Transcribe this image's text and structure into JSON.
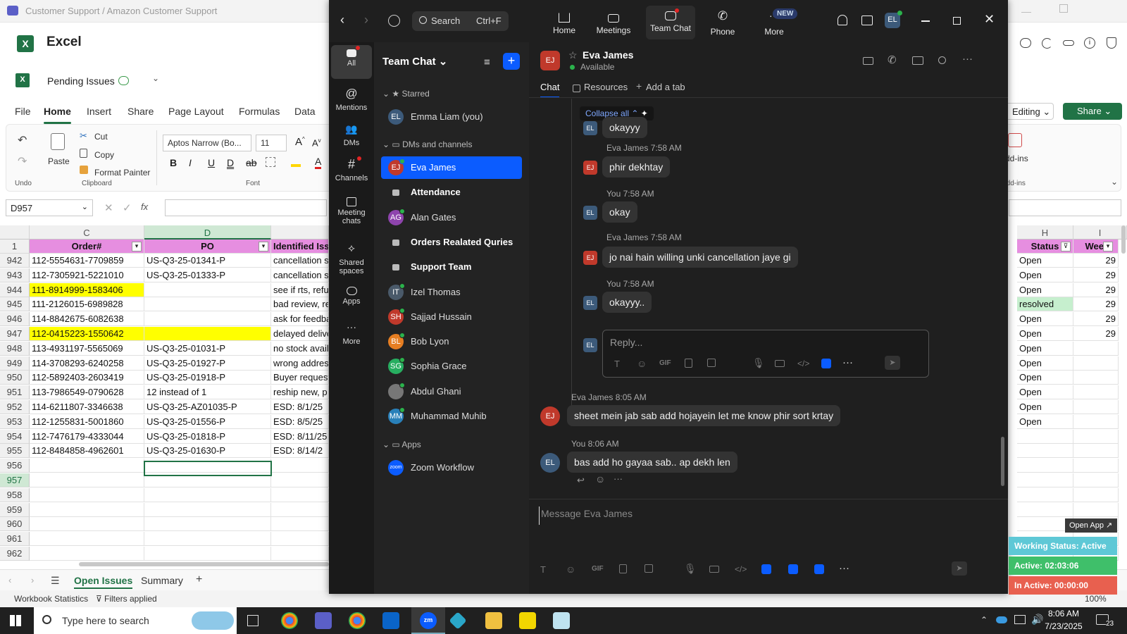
{
  "excel": {
    "window_title": "Customer Support / Amazon Customer Support",
    "app_name": "Excel",
    "file_name": "Pending Issues",
    "menu_tabs": [
      "File",
      "Home",
      "Insert",
      "Share",
      "Page Layout",
      "Formulas",
      "Data"
    ],
    "active_tab": "Home",
    "editing_label": "Editing",
    "share_label": "Share",
    "ribbon": {
      "undo": "Undo",
      "paste": "Paste",
      "cut": "Cut",
      "copy": "Copy",
      "format_painter": "Format Painter",
      "clipboard_group": "Clipboard",
      "font_name": "Aptos Narrow (Bo...",
      "font_size": "11",
      "font_group": "Font",
      "addins": "Add-ins",
      "addins_group": "Add-ins"
    },
    "name_box": "D957",
    "formula_fx": "fx",
    "col_headers": {
      "c": "C",
      "d": "D",
      "h": "H",
      "i": "I"
    },
    "header_row": {
      "num": "1",
      "order": "Order#",
      "po": "PO",
      "issue": "Identified Issu",
      "status": "Status",
      "week": "Weel"
    },
    "rows": [
      {
        "num": "942",
        "order": "112-5554631-7709859",
        "po": "US-Q3-25-01341-P",
        "issue": "cancellation s",
        "status": "Open",
        "week": "29"
      },
      {
        "num": "943",
        "order": "112-7305921-5221010",
        "po": "US-Q3-25-01333-P",
        "issue": "cancellation s",
        "status": "Open",
        "week": "29"
      },
      {
        "num": "944",
        "order": "111-8914999-1583406",
        "po": "",
        "issue": "see if rts, refu",
        "status": "Open",
        "week": "29"
      },
      {
        "num": "945",
        "order": "111-2126015-6989828",
        "po": "",
        "issue": "bad review, re",
        "status": "resolved",
        "week": "29"
      },
      {
        "num": "946",
        "order": "114-8842675-6082638",
        "po": "",
        "issue": "ask for feedba",
        "status": "Open",
        "week": "29"
      },
      {
        "num": "947",
        "order": "112-0415223-1550642",
        "po": "",
        "issue": "delayed delive",
        "status": "Open",
        "week": "29"
      },
      {
        "num": "948",
        "order": "113-4931197-5565069",
        "po": "US-Q3-25-01031-P",
        "issue": "no stock avail",
        "status": "Open",
        "week": ""
      },
      {
        "num": "949",
        "order": "114-3708293-6240258",
        "po": "US-Q3-25-01927-P",
        "issue": "wrong addres",
        "status": "Open",
        "week": ""
      },
      {
        "num": "950",
        "order": "112-5892403-2603419",
        "po": "US-Q3-25-01918-P",
        "issue": "Buyer request",
        "status": "Open",
        "week": ""
      },
      {
        "num": "951",
        "order": "113-7986549-0790628",
        "po": "12 instead of 1",
        "issue": "reship new, p",
        "status": "Open",
        "week": ""
      },
      {
        "num": "952",
        "order": "114-6211807-3346638",
        "po": "US-Q3-25-AZ01035-P",
        "issue": "ESD: 8/1/25",
        "status": "Open",
        "week": ""
      },
      {
        "num": "953",
        "order": "112-1255831-5001860",
        "po": "US-Q3-25-01556-P",
        "issue": "ESD: 8/5/25",
        "status": "Open",
        "week": ""
      },
      {
        "num": "954",
        "order": "112-7476179-4333044",
        "po": "US-Q3-25-01818-P",
        "issue": "ESD: 8/11/25",
        "status": "",
        "week": ""
      },
      {
        "num": "955",
        "order": "112-8484858-4962601",
        "po": "US-Q3-25-01630-P",
        "issue": " ESD: 8/14/2",
        "status": "",
        "week": ""
      },
      {
        "num": "956",
        "order": "",
        "po": "",
        "issue": "",
        "status": "",
        "week": ""
      },
      {
        "num": "957",
        "order": "",
        "po": "",
        "issue": "",
        "status": "",
        "week": ""
      },
      {
        "num": "958",
        "order": "",
        "po": "",
        "issue": "",
        "status": "",
        "week": ""
      },
      {
        "num": "959",
        "order": "",
        "po": "",
        "issue": "",
        "status": "",
        "week": ""
      },
      {
        "num": "960",
        "order": "",
        "po": "",
        "issue": "",
        "status": "",
        "week": ""
      },
      {
        "num": "961",
        "order": "",
        "po": "",
        "issue": "",
        "status": "",
        "week": ""
      },
      {
        "num": "962",
        "order": "",
        "po": "",
        "issue": "",
        "status": "",
        "week": ""
      }
    ],
    "sheet_tabs": [
      "Open Issues",
      "Summary"
    ],
    "active_sheet": "Open Issues",
    "status_left": "Workbook Statistics",
    "status_filters": "Filters applied",
    "zoom_level": "100%"
  },
  "zoom": {
    "search_label": "Search",
    "search_shortcut": "Ctrl+F",
    "nav": [
      "Home",
      "Meetings",
      "Team Chat",
      "Phone",
      "More"
    ],
    "new_badge": "NEW",
    "user_initials": "EL",
    "rail": [
      "All",
      "Mentions",
      "DMs",
      "Channels",
      "Meeting chats",
      "Shared spaces",
      "Apps",
      "More"
    ],
    "list_title": "Team Chat",
    "starred_label": "Starred",
    "dms_label": "DMs and channels",
    "apps_label": "Apps",
    "starred": [
      {
        "initials": "EL",
        "name": "Emma Liam (you)"
      }
    ],
    "contacts": [
      {
        "initials": "EJ",
        "name": "Eva James",
        "kind": "dm",
        "color": "#c0392b"
      },
      {
        "initials": "",
        "name": "Attendance",
        "kind": "channel",
        "color": ""
      },
      {
        "initials": "AG",
        "name": "Alan Gates",
        "kind": "dm",
        "color": "#8e44ad"
      },
      {
        "initials": "",
        "name": "Orders Realated Quries",
        "kind": "channel",
        "color": ""
      },
      {
        "initials": "",
        "name": "Support Team",
        "kind": "channel",
        "color": ""
      },
      {
        "initials": "IT",
        "name": "Izel Thomas",
        "kind": "dm",
        "color": "#4a5a6a"
      },
      {
        "initials": "SH",
        "name": "Sajjad Hussain",
        "kind": "dm",
        "color": "#c0392b"
      },
      {
        "initials": "BL",
        "name": "Bob Lyon",
        "kind": "dm",
        "color": "#e67e22"
      },
      {
        "initials": "SG",
        "name": "Sophia Grace",
        "kind": "dm",
        "color": "#27ae60"
      },
      {
        "initials": "",
        "name": "Abdul Ghani",
        "kind": "photo",
        "color": "#777"
      },
      {
        "initials": "MM",
        "name": "Muhammad Muhib",
        "kind": "dm",
        "color": "#2980b9"
      }
    ],
    "apps": [
      {
        "initials": "zoom",
        "name": "Zoom Workflow"
      }
    ],
    "chat": {
      "contact_name": "Eva James",
      "contact_status": "Available",
      "contact_initials": "EJ",
      "tabs": [
        "Chat",
        "Resources",
        "Add a tab"
      ],
      "collapse_all": "Collapse all",
      "thread": [
        {
          "who": "EL",
          "head": "",
          "text": "okayyy"
        },
        {
          "who": "EJ",
          "head": "Eva James 7:58 AM",
          "text": "phir dekhtay"
        },
        {
          "who": "EL",
          "head": "You 7:58 AM",
          "text": "okay"
        },
        {
          "who": "EJ",
          "head": "Eva James 7:58 AM",
          "text": "jo nai hain willing unki cancellation jaye gi"
        },
        {
          "who": "EL",
          "head": "You 7:58 AM",
          "text": "okayyy.."
        }
      ],
      "reply_placeholder": "Reply...",
      "messages": [
        {
          "who": "EJ",
          "head": "Eva James 8:05 AM",
          "text": "sheet mein jab sab add hojayein let me know phir sort krtay"
        },
        {
          "who": "EL",
          "head": "You 8:06 AM",
          "text": "bas add ho gayaa sab.. ap dekh len"
        }
      ],
      "input_placeholder": "Message Eva James",
      "gif_label": "GIF"
    }
  },
  "widget": {
    "open_app": "Open App ↗",
    "working_status": "Working Status: Active",
    "active": "Active: 02:03:06",
    "inactive": "In Active: 00:00:00"
  },
  "taskbar": {
    "search_placeholder": "Type here to search",
    "time": "8:06 AM",
    "date": "7/23/2025",
    "notif_count": "23"
  }
}
